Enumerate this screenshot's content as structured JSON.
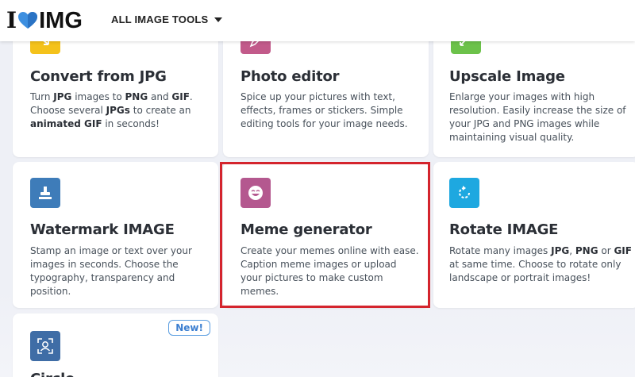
{
  "header": {
    "logo_prefix": "I",
    "logo_suffix": "IMG",
    "nav_tools_label": "ALL IMAGE TOOLS"
  },
  "colors": {
    "convert_icon": "#f4c21b",
    "photo_icon": "#c25a8a",
    "upscale_icon": "#6cc24a",
    "watermark_icon": "#3e7cb9",
    "meme_icon": "#b4588f",
    "rotate_icon": "#1ea8e0",
    "crop_icon": "#3f6da6",
    "highlight": "#d4242d",
    "badge": "#3b7ed0"
  },
  "cards": {
    "convert": {
      "title": "Convert from JPG",
      "desc_1": "Turn ",
      "desc_jpg": "JPG",
      "desc_2": " images to ",
      "desc_png": "PNG",
      "desc_3": " and ",
      "desc_gif": "GIF",
      "desc_4": ".",
      "desc_5": "Choose several ",
      "desc_jpgs": "JPGs",
      "desc_6": " to create an",
      "desc_animated": "animated GIF",
      "desc_7": " in seconds!",
      "icon": "convert-jpg-icon"
    },
    "photo_editor": {
      "title": "Photo editor",
      "desc": "Spice up your pictures with text, effects, frames or stickers. Simple editing tools for your image needs.",
      "icon": "photo-editor-icon"
    },
    "upscale": {
      "title": "Upscale Image",
      "desc": "Enlarge your images with high resolution. Easily increase the size of your JPG and PNG images while maintaining visual quality.",
      "icon": "upscale-icon"
    },
    "watermark": {
      "title": "Watermark IMAGE",
      "desc": "Stamp an image or text over your images in seconds. Choose the typography, transparency and position.",
      "icon": "stamp-icon"
    },
    "meme": {
      "title": "Meme generator",
      "desc": "Create your memes online with ease. Caption meme images or upload your pictures to make custom memes.",
      "icon": "smiley-icon"
    },
    "rotate": {
      "title": "Rotate IMAGE",
      "desc_1": "Rotate many images ",
      "desc_jpg": "JPG",
      "desc_2": ", ",
      "desc_png": "PNG",
      "desc_3": " or ",
      "desc_gif": "GIF",
      "desc_4": "at same time. Choose to rotate only landscape or portrait images!",
      "icon": "rotate-icon"
    },
    "last": {
      "title": "Circle...",
      "badge": "New!",
      "icon": "face-crop-icon"
    }
  }
}
